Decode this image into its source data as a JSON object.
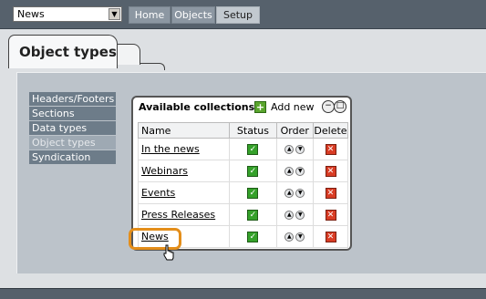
{
  "topbar": {
    "select_value": "News",
    "nav": [
      "Home",
      "Objects",
      "Setup"
    ],
    "active_nav": "Setup"
  },
  "tabs": {
    "active_label": "Object types"
  },
  "sidebar": {
    "items": [
      {
        "label": "Headers/Footers"
      },
      {
        "label": "Sections"
      },
      {
        "label": "Data types"
      },
      {
        "label": "Object types",
        "selected": true
      },
      {
        "label": "Syndication"
      }
    ]
  },
  "collections": {
    "title": "Available collections",
    "add_label": "Add new",
    "columns": [
      "Name",
      "Status",
      "Order",
      "Delete"
    ],
    "rows": [
      {
        "name": "In the news",
        "status": "active"
      },
      {
        "name": "Webinars",
        "status": "active"
      },
      {
        "name": "Events",
        "status": "active"
      },
      {
        "name": "Press Releases",
        "status": "active"
      },
      {
        "name": "News",
        "status": "active"
      }
    ]
  },
  "colors": {
    "highlight": "#e48e1a",
    "status_active": "#35a12a",
    "delete": "#d93c24"
  }
}
